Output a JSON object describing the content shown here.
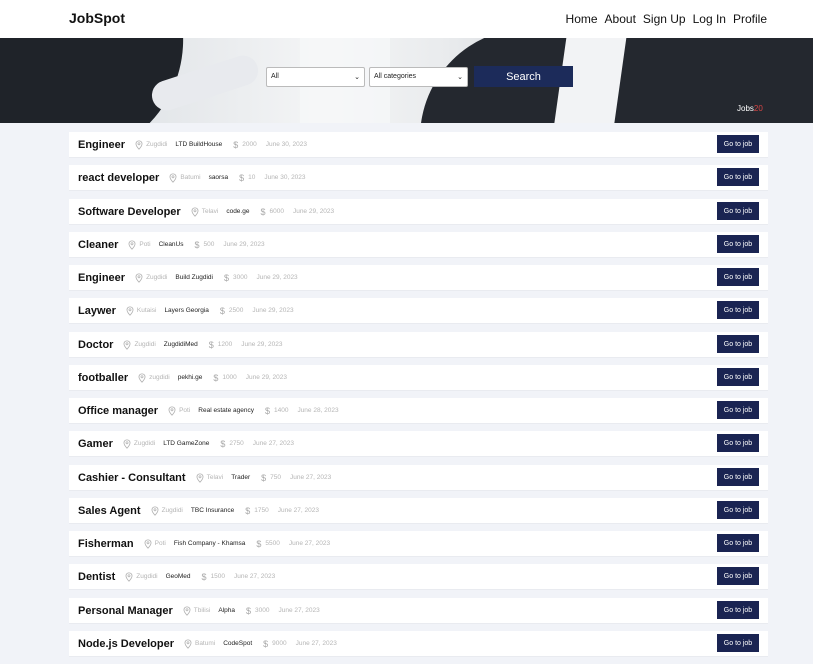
{
  "navbar": {
    "brand": "JobSpot",
    "links": [
      "Home",
      "About",
      "Sign Up",
      "Log In",
      "Profile"
    ]
  },
  "search": {
    "location_value": "All",
    "category_value": "All categories",
    "button_label": "Search"
  },
  "jobs_count": {
    "label": "Jobs",
    "count": "20"
  },
  "jobs": [
    {
      "title": "Engineer",
      "city": "Zugdidi",
      "company": "LTD BuildHouse",
      "salary": "2000",
      "date": "June 30, 2023"
    },
    {
      "title": "react developer",
      "city": "Batumi",
      "company": "saorsa",
      "salary": "10",
      "date": "June 30, 2023"
    },
    {
      "title": "Software Developer",
      "city": "Telavi",
      "company": "code.ge",
      "salary": "6000",
      "date": "June 29, 2023"
    },
    {
      "title": "Cleaner",
      "city": "Poti",
      "company": "CleanUs",
      "salary": "500",
      "date": "June 29, 2023"
    },
    {
      "title": "Engineer",
      "city": "Zugdidi",
      "company": "Build Zugdidi",
      "salary": "3000",
      "date": "June 29, 2023"
    },
    {
      "title": "Laywer",
      "city": "Kutaisi",
      "company": "Layers Georgia",
      "salary": "2500",
      "date": "June 29, 2023"
    },
    {
      "title": "Doctor",
      "city": "Zugdidi",
      "company": "ZugdidiMed",
      "salary": "1200",
      "date": "June 29, 2023"
    },
    {
      "title": "footballer",
      "city": "zugdidi",
      "company": "pekhi.ge",
      "salary": "1000",
      "date": "June 29, 2023"
    },
    {
      "title": "Office manager",
      "city": "Poti",
      "company": "Real estate agency",
      "salary": "1400",
      "date": "June 28, 2023"
    },
    {
      "title": "Gamer",
      "city": "Zugdidi",
      "company": "LTD GameZone",
      "salary": "2750",
      "date": "June 27, 2023"
    },
    {
      "title": "Cashier - Consultant",
      "city": "Telavi",
      "company": "Trader",
      "salary": "750",
      "date": "June 27, 2023"
    },
    {
      "title": "Sales Agent",
      "city": "Zugdidi",
      "company": "TBC Insurance",
      "salary": "1750",
      "date": "June 27, 2023"
    },
    {
      "title": "Fisherman",
      "city": "Poti",
      "company": "Fish Company - Khamsa",
      "salary": "5500",
      "date": "June 27, 2023"
    },
    {
      "title": "Dentist",
      "city": "Zugdidi",
      "company": "GeoMed",
      "salary": "1500",
      "date": "June 27, 2023"
    },
    {
      "title": "Personal Manager",
      "city": "Tbilisi",
      "company": "Alpha",
      "salary": "3000",
      "date": "June 27, 2023"
    },
    {
      "title": "Node.js Developer",
      "city": "Batumi",
      "company": "CodeSpot",
      "salary": "9000",
      "date": "June 27, 2023"
    }
  ],
  "go_button_label": "Go to job",
  "icons": {
    "location": "map-pin-icon",
    "salary": "dollar-icon",
    "dropdown": "chevron-down-icon"
  },
  "colors": {
    "primary": "#1a2452",
    "count_accent": "#d64545",
    "page_bg": "#f1f3f8"
  }
}
